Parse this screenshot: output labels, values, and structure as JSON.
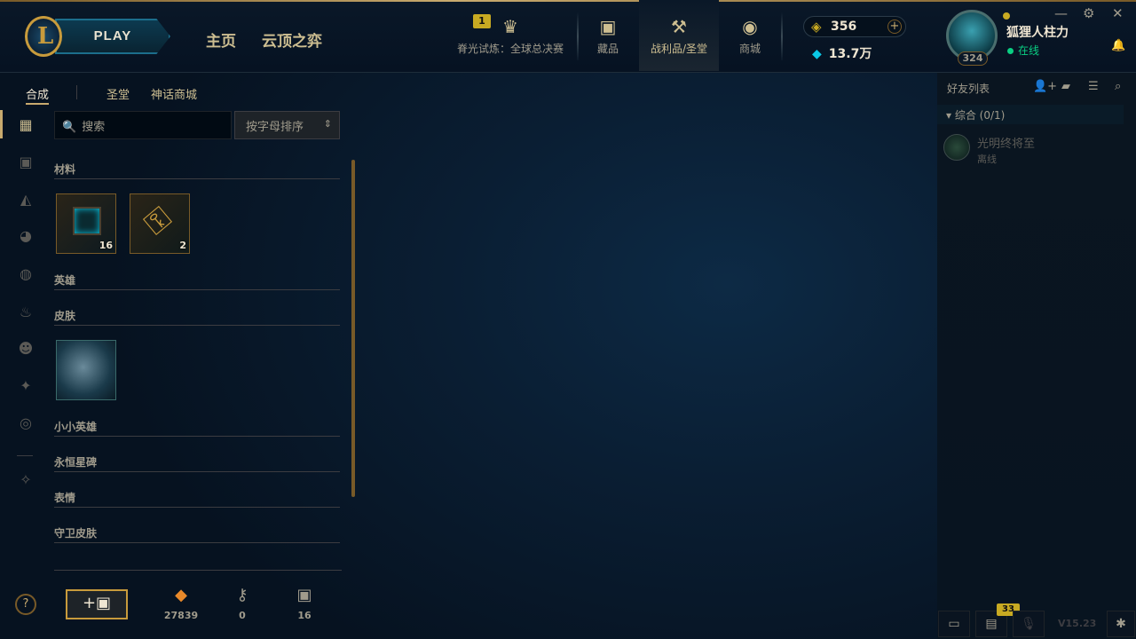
{
  "header": {
    "play_label": "PLAY",
    "nav": [
      "主页",
      "云顶之弈"
    ],
    "event_badge": "1",
    "tabs": [
      {
        "label": "脊光试炼：全球总决赛"
      },
      {
        "label": "藏品"
      },
      {
        "label": "战利品/圣堂"
      },
      {
        "label": "商城"
      }
    ],
    "rp": "356",
    "blue_essence": "13.7万"
  },
  "profile": {
    "level": "324",
    "name": "狐狸人柱力",
    "status": "在线"
  },
  "subnav": [
    "合成",
    "圣堂",
    "神话商城"
  ],
  "search": {
    "placeholder": "搜索"
  },
  "sort": {
    "label": "按字母排序"
  },
  "categories": [
    "材料",
    "英雄",
    "皮肤",
    "小小英雄",
    "永恒星碑",
    "表情",
    "守卫皮肤"
  ],
  "materials": [
    {
      "name": "chest",
      "count": "16"
    },
    {
      "name": "key",
      "count": "2"
    }
  ],
  "bottom": {
    "orange_essence": "27839",
    "keys": "0",
    "chests": "16"
  },
  "friends": {
    "title": "好友列表",
    "group": "综合 (0/1)",
    "list": [
      {
        "name": "光明终将至",
        "status": "离线"
      }
    ]
  },
  "footer": {
    "notif_count": "33",
    "version": "V15.23"
  }
}
